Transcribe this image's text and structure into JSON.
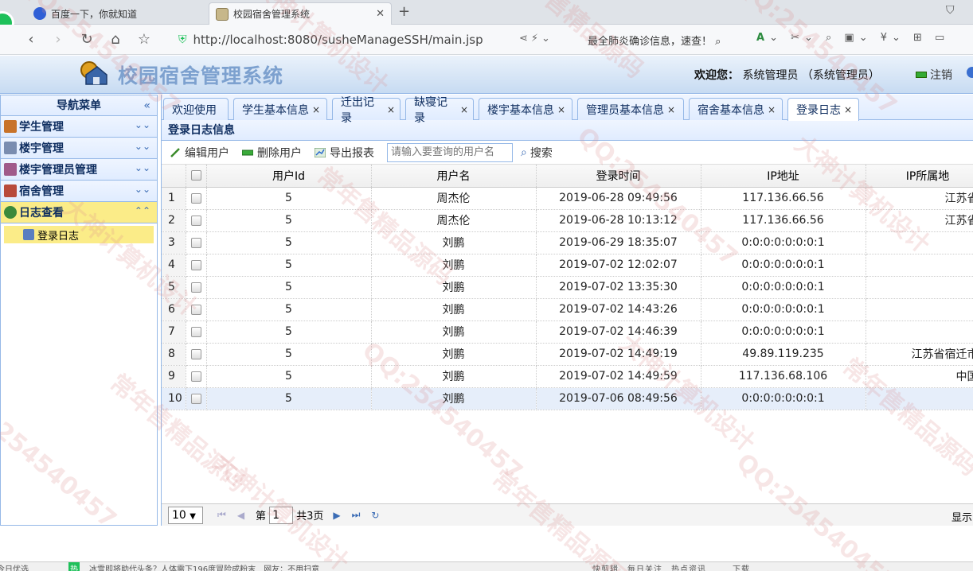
{
  "browser": {
    "tabs": [
      {
        "title": "百度一下，你就知道"
      },
      {
        "title": "校园宿舍管理系统"
      }
    ],
    "url": "http://localhost:8080/susheManageSSH/main.jsp",
    "news_text": "最全肺炎确诊信息，速查！",
    "new_tab": "+"
  },
  "header": {
    "title": "校园宿舍管理系统",
    "welcome_label": "欢迎您：",
    "welcome_user": "系统管理员 （系统管理员）",
    "logout": "注销"
  },
  "sidebar": {
    "title": "导航菜单",
    "groups": [
      {
        "label": "学生管理"
      },
      {
        "label": "楼宇管理"
      },
      {
        "label": "楼宇管理员管理"
      },
      {
        "label": "宿舍管理"
      },
      {
        "label": "日志查看"
      }
    ],
    "sub_item": "登录日志"
  },
  "tabs": [
    {
      "label": "欢迎使用"
    },
    {
      "label": "学生基本信息"
    },
    {
      "label": "迁出记录"
    },
    {
      "label": "缺寝记录"
    },
    {
      "label": "楼宇基本信息"
    },
    {
      "label": "管理员基本信息"
    },
    {
      "label": "宿舍基本信息"
    },
    {
      "label": "登录日志"
    }
  ],
  "panel": {
    "title": "登录日志信息",
    "toolbar": {
      "edit": "编辑用户",
      "delete": "删除用户",
      "export": "导出报表",
      "search_placeholder": "请输入要查询的用户名",
      "search": "搜索"
    }
  },
  "grid": {
    "columns": [
      "用户Id",
      "用户名",
      "登录时间",
      "IP地址",
      "IP所属地"
    ],
    "rows": [
      {
        "n": "1",
        "id": "5",
        "name": "周杰伦",
        "time": "2019-06-28 09:49:56",
        "ip": "117.136.66.56",
        "loc": "江苏省"
      },
      {
        "n": "2",
        "id": "5",
        "name": "周杰伦",
        "time": "2019-06-28 10:13:12",
        "ip": "117.136.66.56",
        "loc": "江苏省"
      },
      {
        "n": "3",
        "id": "5",
        "name": "刘鹏",
        "time": "2019-06-29 18:35:07",
        "ip": "0:0:0:0:0:0:0:1",
        "loc": ""
      },
      {
        "n": "4",
        "id": "5",
        "name": "刘鹏",
        "time": "2019-07-02 12:02:07",
        "ip": "0:0:0:0:0:0:0:1",
        "loc": ""
      },
      {
        "n": "5",
        "id": "5",
        "name": "刘鹏",
        "time": "2019-07-02 13:35:30",
        "ip": "0:0:0:0:0:0:0:1",
        "loc": ""
      },
      {
        "n": "6",
        "id": "5",
        "name": "刘鹏",
        "time": "2019-07-02 14:43:26",
        "ip": "0:0:0:0:0:0:0:1",
        "loc": ""
      },
      {
        "n": "7",
        "id": "5",
        "name": "刘鹏",
        "time": "2019-07-02 14:46:39",
        "ip": "0:0:0:0:0:0:0:1",
        "loc": ""
      },
      {
        "n": "8",
        "id": "5",
        "name": "刘鹏",
        "time": "2019-07-02 14:49:19",
        "ip": "49.89.119.235",
        "loc": "江苏省宿迁市"
      },
      {
        "n": "9",
        "id": "5",
        "name": "刘鹏",
        "time": "2019-07-02 14:49:59",
        "ip": "117.136.68.106",
        "loc": "中国"
      },
      {
        "n": "10",
        "id": "5",
        "name": "刘鹏",
        "time": "2019-07-06 08:49:56",
        "ip": "0:0:0:0:0:0:0:1",
        "loc": ""
      }
    ]
  },
  "pager": {
    "page_size": "10",
    "page_prefix": "第",
    "page": "1",
    "total": "共3页",
    "display": "显示"
  },
  "statusbar": {
    "left": "今日优选",
    "hot": "热",
    "news": "冰雪即将助代头条？人体需下196度冒险成粉末　网友：不用扫意",
    "right": "快剪辑　每日关注　热点资讯　　　下载"
  },
  "watermark": {
    "texts": [
      "QQ:254540457",
      "大神计算机设计",
      "常年售精品源码"
    ]
  }
}
